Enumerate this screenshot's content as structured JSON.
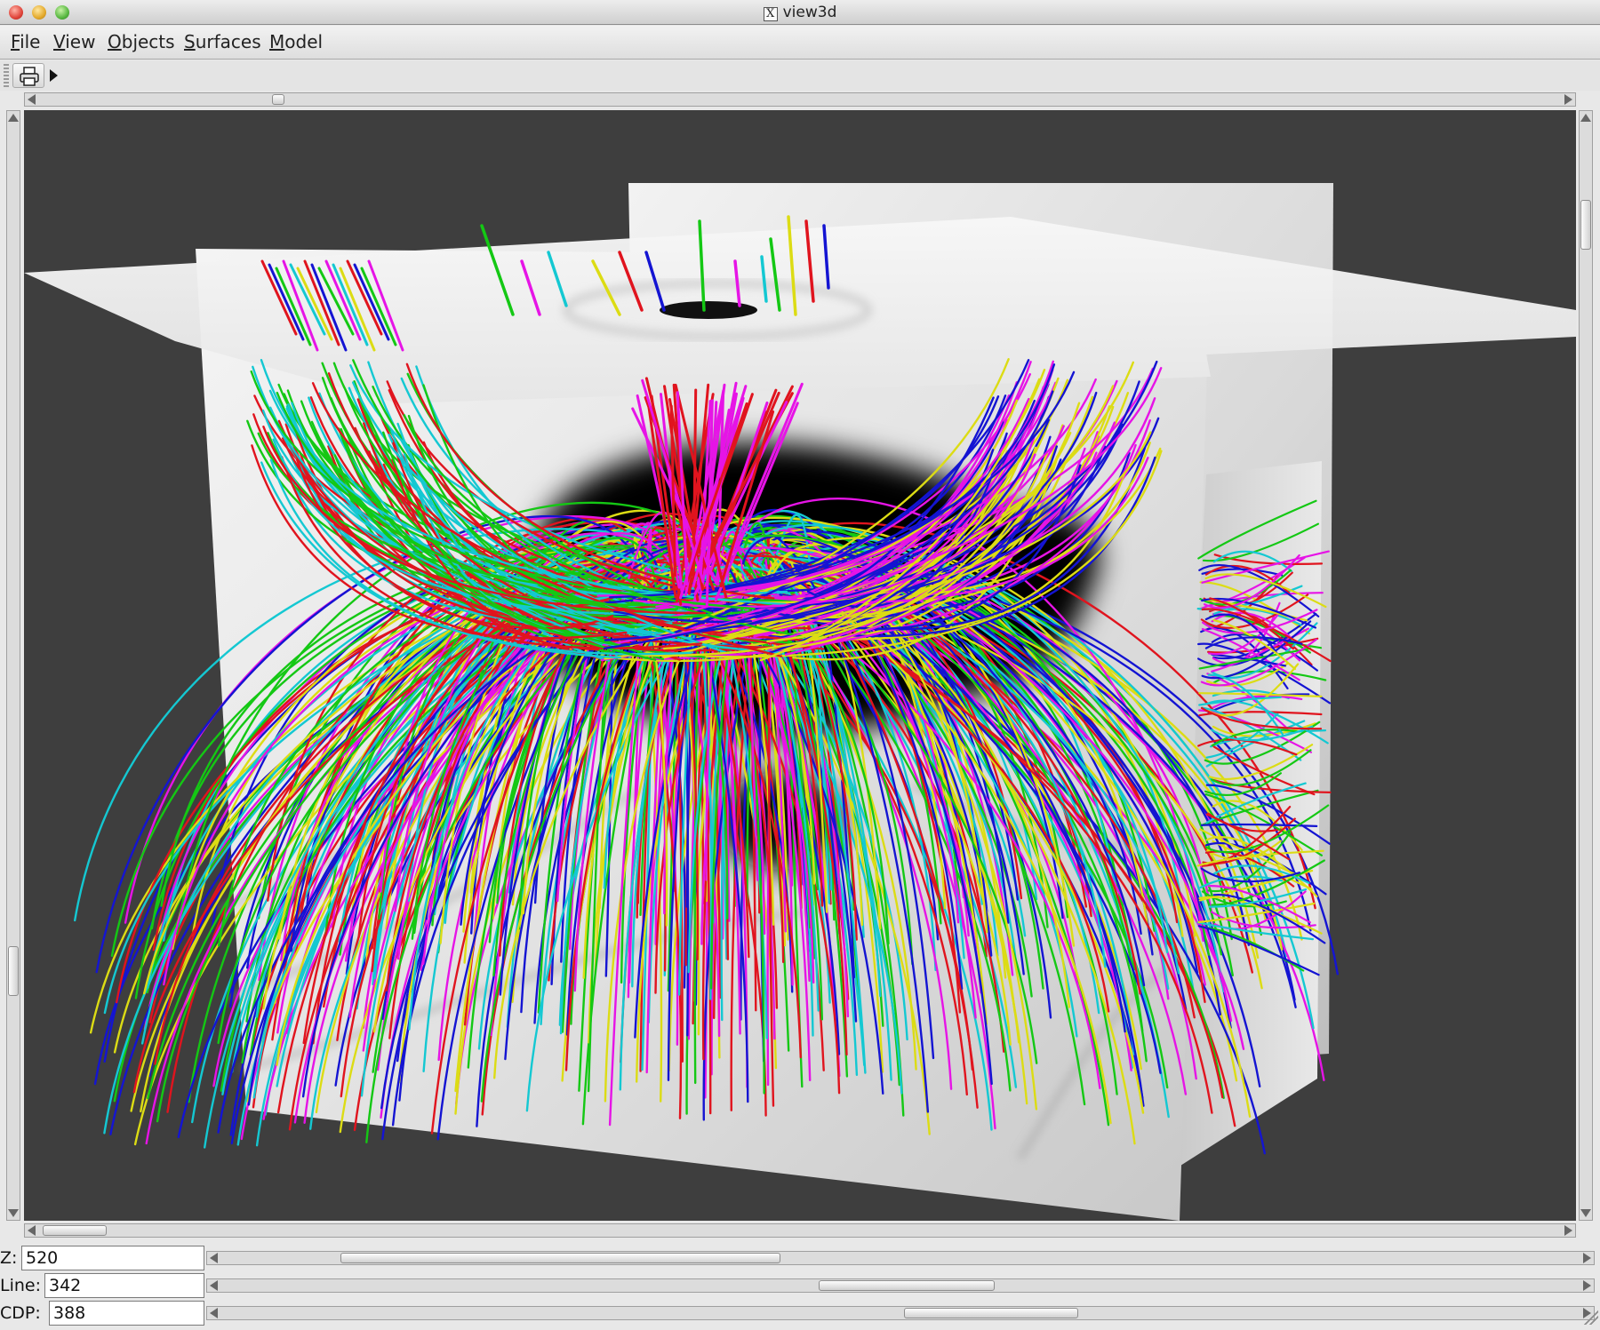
{
  "window": {
    "title": "view3d",
    "x_icon": "X"
  },
  "menu": {
    "items": [
      {
        "label": "File",
        "mnemonic": "F",
        "rest": "ile"
      },
      {
        "label": "View",
        "mnemonic": "V",
        "rest": "iew"
      },
      {
        "label": "Objects",
        "mnemonic": "O",
        "rest": "bjects"
      },
      {
        "label": "Surfaces",
        "mnemonic": "S",
        "rest": "urfaces"
      },
      {
        "label": "Model",
        "mnemonic": "M",
        "rest": "odel"
      }
    ]
  },
  "toolbar": {
    "print_icon": "printer-icon",
    "play_icon": "play-icon"
  },
  "sliders": {
    "z": {
      "label": "Z:",
      "value": "520"
    },
    "line": {
      "label": "Line:",
      "value": "342"
    },
    "cdp": {
      "label": "CDP:",
      "value": "388"
    }
  },
  "colors": {
    "background": "#3e3e3e",
    "streamlines": [
      "#e0141e",
      "#1414d2",
      "#14c814",
      "#e614e6",
      "#14c8d2",
      "#dcdc14"
    ]
  }
}
